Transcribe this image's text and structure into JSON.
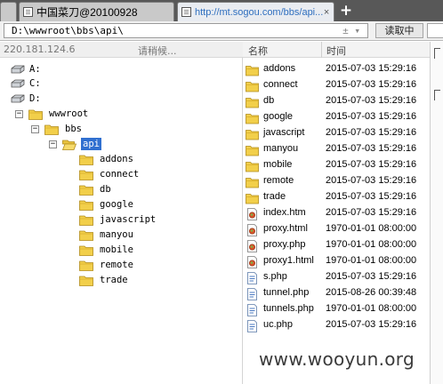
{
  "tabs": {
    "inactive_title": "中国菜刀@20100928",
    "active_title": "http://mt.sogou.com/bbs/api...",
    "close_glyph": "×",
    "new_tab_glyph": "+"
  },
  "pathbar": {
    "path": "D:\\wwwroot\\bbs\\api\\",
    "tools": "±  ▾",
    "button_label": "读取中"
  },
  "left_status": {
    "ip": "220.181.124.6",
    "message": "请稍候..."
  },
  "tree": {
    "drives": [
      "A:",
      "C:",
      "D:"
    ],
    "folders": {
      "wwwroot": "wwwroot",
      "bbs": "bbs",
      "api": "api"
    },
    "api_children": [
      "addons",
      "connect",
      "db",
      "google",
      "javascript",
      "manyou",
      "mobile",
      "remote",
      "trade"
    ],
    "expand_minus": "−"
  },
  "file_list": {
    "col_name": "名称",
    "col_time": "时间",
    "rows": [
      {
        "name": "addons",
        "time": "2015-07-03 15:29:16",
        "icon": "folder-icon"
      },
      {
        "name": "connect",
        "time": "2015-07-03 15:29:16",
        "icon": "folder-icon"
      },
      {
        "name": "db",
        "time": "2015-07-03 15:29:16",
        "icon": "folder-icon"
      },
      {
        "name": "google",
        "time": "2015-07-03 15:29:16",
        "icon": "folder-icon"
      },
      {
        "name": "javascript",
        "time": "2015-07-03 15:29:16",
        "icon": "folder-icon"
      },
      {
        "name": "manyou",
        "time": "2015-07-03 15:29:16",
        "icon": "folder-icon"
      },
      {
        "name": "mobile",
        "time": "2015-07-03 15:29:16",
        "icon": "folder-icon"
      },
      {
        "name": "remote",
        "time": "2015-07-03 15:29:16",
        "icon": "folder-icon"
      },
      {
        "name": "trade",
        "time": "2015-07-03 15:29:16",
        "icon": "folder-icon"
      },
      {
        "name": "index.htm",
        "time": "2015-07-03 15:29:16",
        "icon": "html-file-icon"
      },
      {
        "name": "proxy.html",
        "time": "1970-01-01 08:00:00",
        "icon": "html-file-icon"
      },
      {
        "name": "proxy.php",
        "time": "1970-01-01 08:00:00",
        "icon": "html-file-icon"
      },
      {
        "name": "proxy1.html",
        "time": "1970-01-01 08:00:00",
        "icon": "html-file-icon"
      },
      {
        "name": "s.php",
        "time": "2015-07-03 15:29:16",
        "icon": "php-file-icon"
      },
      {
        "name": "tunnel.php",
        "time": "2015-08-26 00:39:48",
        "icon": "php-file-icon"
      },
      {
        "name": "tunnels.php",
        "time": "1970-01-01 08:00:00",
        "icon": "php-file-icon"
      },
      {
        "name": "uc.php",
        "time": "2015-07-03 15:29:16",
        "icon": "php-file-icon"
      }
    ]
  },
  "watermark": "www.wooyun.org",
  "colors": {
    "tabbar": "#585858",
    "active_tab_text": "#2f6fbf",
    "selection": "#3070d0",
    "folder": "#f2cf4a"
  }
}
